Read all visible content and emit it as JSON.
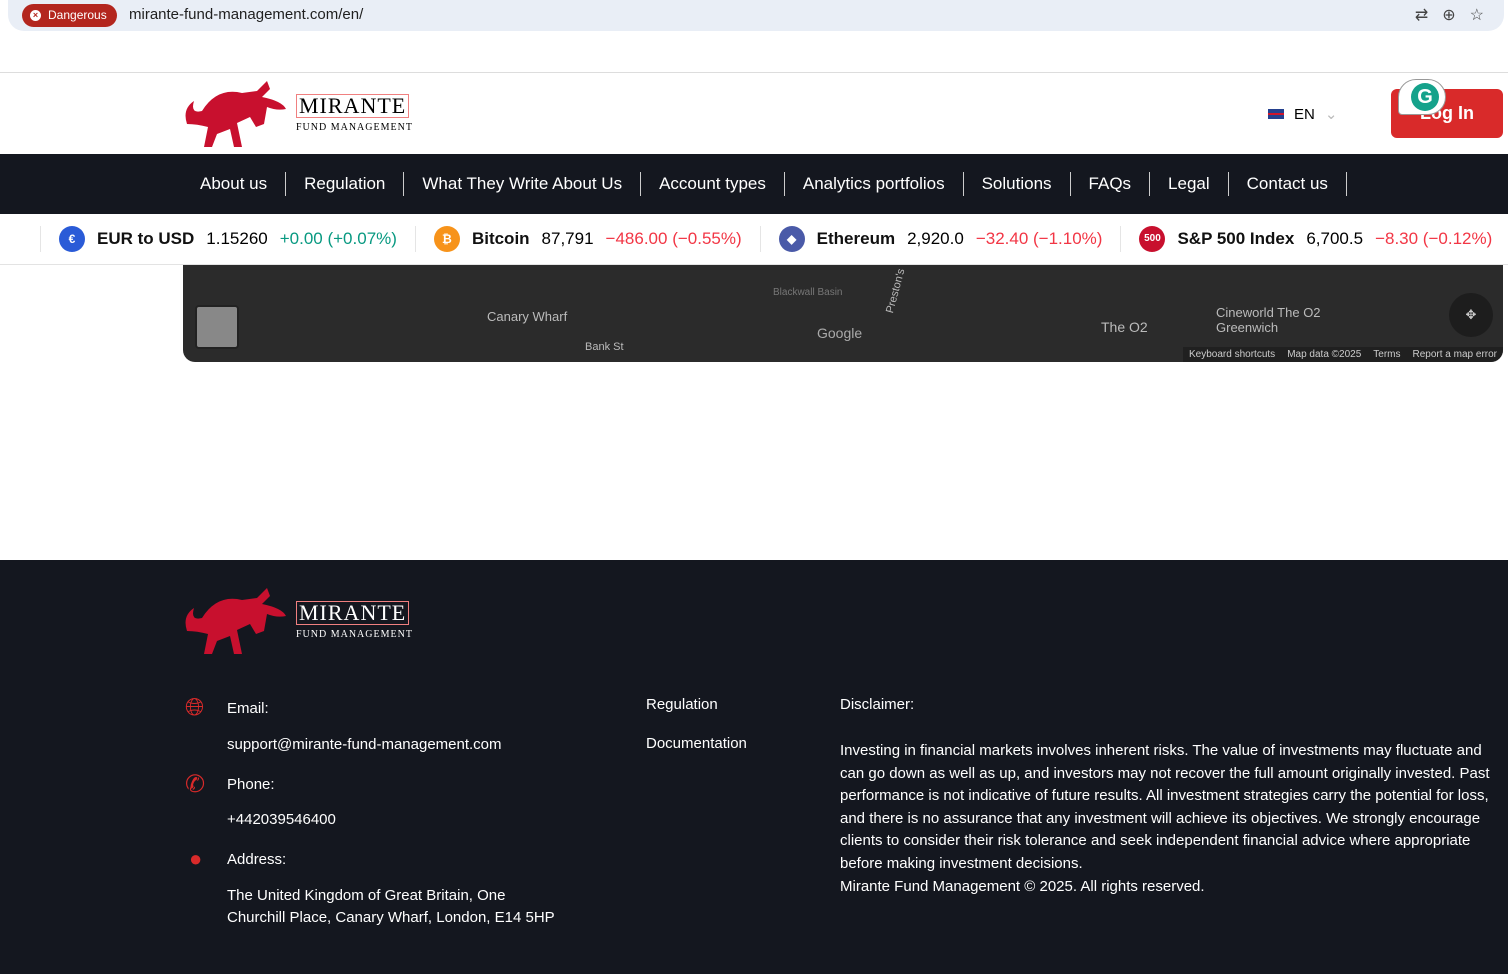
{
  "browser": {
    "danger_label": "Dangerous",
    "url": "mirante-fund-management.com/en/"
  },
  "brand": {
    "name": "MIRANTE",
    "subtitle": "FUND MANAGEMENT"
  },
  "header": {
    "language": "EN",
    "login": "Log In"
  },
  "nav": [
    "About us",
    "Regulation",
    "What They Write About Us",
    "Account types",
    "Analytics portfolios",
    "Solutions",
    "FAQs",
    "Legal",
    "Contact us"
  ],
  "ticker": [
    {
      "name": "EUR to USD",
      "price": "1.15260",
      "change": "+0.00 (+0.07%)",
      "dir": "up",
      "icon": "eu-us-flag-icon",
      "color": "#2a5bd7",
      "glyph": "€"
    },
    {
      "name": "Bitcoin",
      "price": "87,791",
      "change": "−486.00 (−0.55%)",
      "dir": "dn",
      "icon": "bitcoin-icon",
      "color": "#f7931a",
      "glyph": "₿"
    },
    {
      "name": "Ethereum",
      "price": "2,920.0",
      "change": "−32.40 (−1.10%)",
      "dir": "dn",
      "icon": "ethereum-icon",
      "color": "#4a5aa8",
      "glyph": "◆"
    },
    {
      "name": "S&P 500 Index",
      "price": "6,700.5",
      "change": "−8.30 (−0.12%)",
      "dir": "dn",
      "icon": "sp500-icon",
      "color": "#c8102e",
      "glyph": "500"
    }
  ],
  "map": {
    "labels": [
      "Canary Wharf",
      "Bank St",
      "Blackwall Basin",
      "Preston's",
      "The O2",
      "Cineworld The O2 Greenwich",
      "Google"
    ],
    "attribution": [
      "Keyboard shortcuts",
      "Map data ©2025",
      "Terms",
      "Report a map error"
    ]
  },
  "footer": {
    "email_label": "Email:",
    "email": "support@mirante-fund-management.com",
    "phone_label": "Phone:",
    "phone": "+442039546400",
    "address_label": "Address:",
    "address_line1": "The United Kingdom of Great Britain, One",
    "address_line2": "Churchill Place, Canary Wharf, London, E14 5HP",
    "links": [
      "Regulation",
      "Documentation"
    ],
    "disclaimer_title": "Disclaimer:",
    "disclaimer": "Investing in financial markets involves inherent risks. The value of investments may fluctuate and can go down as well as up, and investors may not recover the full amount originally invested. Past performance is not indicative of future results. All investment strategies carry the potential for loss, and there is no assurance that any investment will achieve its objectives. We strongly encourage clients to consider their risk tolerance and seek independent financial advice where appropriate before making investment decisions.",
    "copyright": "Mirante Fund Management © 2025. All rights reserved."
  }
}
